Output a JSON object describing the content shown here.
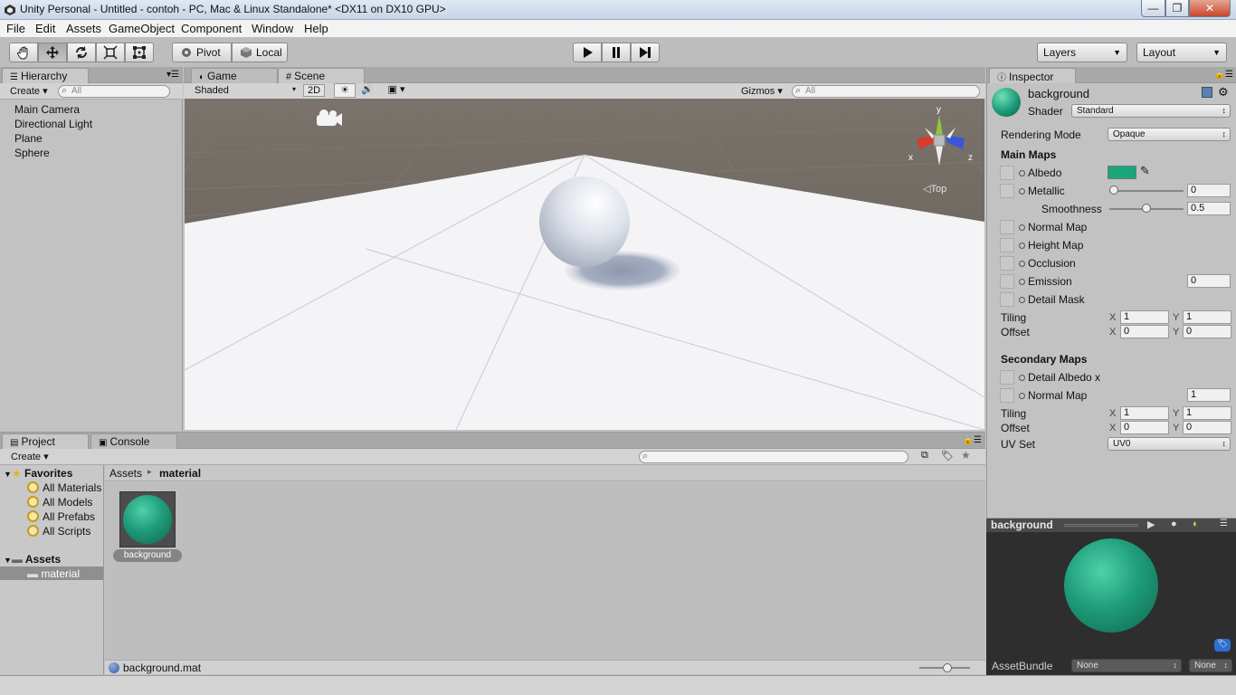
{
  "window": {
    "title": "Unity Personal - Untitled - contoh - PC, Mac & Linux Standalone* <DX11 on DX10 GPU>",
    "minimize": "—",
    "maximize": "❐",
    "close": "✕"
  },
  "menu": [
    "File",
    "Edit",
    "Assets",
    "GameObject",
    "Component",
    "Window",
    "Help"
  ],
  "toolbar": {
    "pivot": "Pivot",
    "local": "Local",
    "layers": "Layers",
    "layout": "Layout"
  },
  "hierarchy": {
    "tab": "Hierarchy",
    "create": "Create ▾",
    "search_placeholder": "All",
    "items": [
      "Main Camera",
      "Directional Light",
      "Plane",
      "Sphere"
    ]
  },
  "scene": {
    "tab_game": "Game",
    "tab_scene": "Scene",
    "shading": "Shaded",
    "mode_2d": "2D",
    "gizmos": "Gizmos ▾",
    "search_placeholder": "All",
    "gizmo_view": "Top",
    "axis_x": "x",
    "axis_y": "y",
    "axis_z": "z"
  },
  "inspector": {
    "tab": "Inspector",
    "material_name": "background",
    "shader_label": "Shader",
    "shader_value": "Standard",
    "rendering_mode_label": "Rendering Mode",
    "rendering_mode_value": "Opaque",
    "main_maps": "Main Maps",
    "albedo": "Albedo",
    "albedo_color": "#18a67a",
    "metallic": "Metallic",
    "metallic_value": "0",
    "metallic_fraction": 0,
    "smoothness": "Smoothness",
    "smoothness_value": "0.5",
    "smoothness_fraction": 0.5,
    "normal_map": "Normal Map",
    "height_map": "Height Map",
    "occlusion": "Occlusion",
    "emission": "Emission",
    "emission_value": "0",
    "detail_mask": "Detail Mask",
    "tiling": "Tiling",
    "offset": "Offset",
    "x_label": "X",
    "y_label": "Y",
    "tiling_x": "1",
    "tiling_y": "1",
    "offset_x": "0",
    "offset_y": "0",
    "secondary_maps": "Secondary Maps",
    "detail_albedo": "Detail Albedo x",
    "sec_normal_map": "Normal Map",
    "sec_normal_value": "1",
    "sec_tiling_x": "1",
    "sec_tiling_y": "1",
    "sec_offset_x": "0",
    "sec_offset_y": "0",
    "uv_set": "UV Set",
    "uv_set_value": "UV0"
  },
  "preview": {
    "title": "background",
    "asset_bundle_label": "AssetBundle",
    "asset_bundle_value": "None",
    "asset_variant_value": "None"
  },
  "project": {
    "tab_project": "Project",
    "tab_console": "Console",
    "create": "Create ▾",
    "favorites": "Favorites",
    "favorites_items": [
      "All Materials",
      "All Models",
      "All Prefabs",
      "All Scripts"
    ],
    "assets": "Assets",
    "assets_folder": "material",
    "breadcrumb_root": "Assets",
    "breadcrumb_sep": "▸",
    "breadcrumb_current": "material",
    "asset_name": "background",
    "status_file": "background.mat"
  },
  "colors": {
    "material_green": "#1d9a7a",
    "selection_blue": "#3b6fb6"
  }
}
